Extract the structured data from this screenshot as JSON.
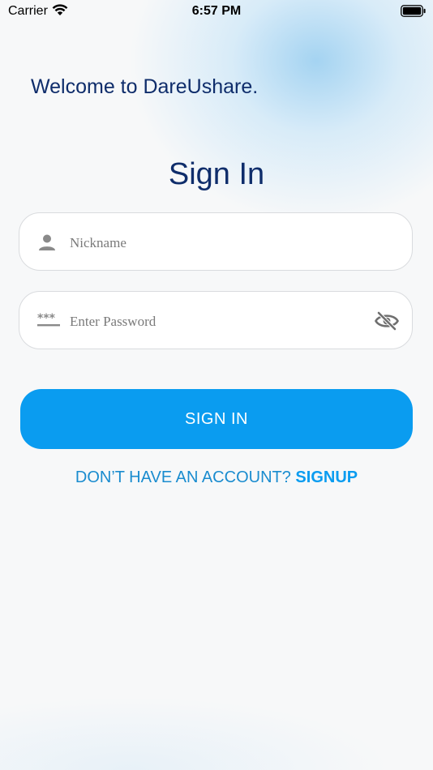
{
  "status_bar": {
    "carrier": "Carrier",
    "time": "6:57 PM"
  },
  "welcome_text": "Welcome to DareUshare.",
  "title": "Sign In",
  "nickname_field": {
    "placeholder": "Nickname",
    "value": "",
    "icon": "person-icon"
  },
  "password_field": {
    "placeholder": "Enter Password",
    "value": "",
    "icon": "password-dots-icon",
    "toggle_icon": "eye-off-icon"
  },
  "sign_in_button": {
    "label": "SIGN IN"
  },
  "signup_prompt": {
    "text": "DON’T HAVE AN ACCOUNT? ",
    "link": "SIGNUP"
  },
  "colors": {
    "primary": "#0a9cf0",
    "title": "#0f2d6b",
    "link": "#1a8ccf"
  }
}
